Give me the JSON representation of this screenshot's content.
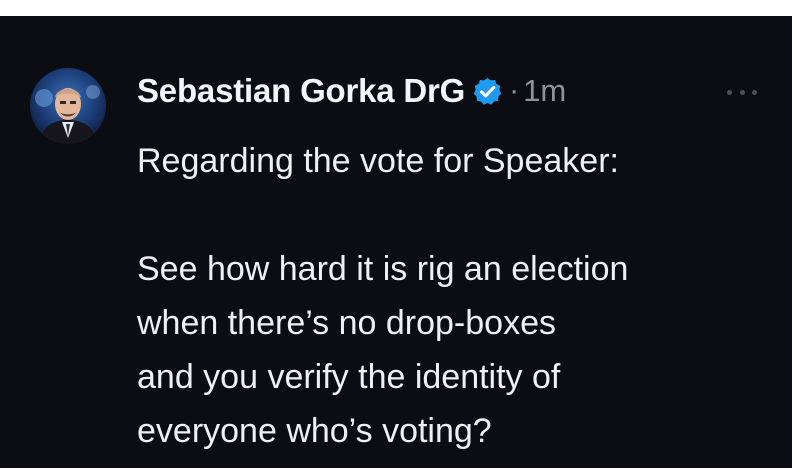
{
  "tweet": {
    "author": {
      "display_name": "Sebastian Gorka DrG",
      "verified": true,
      "avatar_icon": "user-avatar"
    },
    "separator": "·",
    "timestamp": "1m",
    "more_icon": "more-options-icon",
    "body": {
      "first_line": "Regarding the vote for Speaker:",
      "lines": [
        "See how hard it is rig an election",
        "when there’s no drop-boxes",
        "and you verify the identity of",
        "everyone who’s voting?"
      ]
    }
  },
  "colors": {
    "background": "#0c0d12",
    "text": "#eef0f2",
    "muted": "#8b949c",
    "verified_badge": "#1d9bf0"
  }
}
